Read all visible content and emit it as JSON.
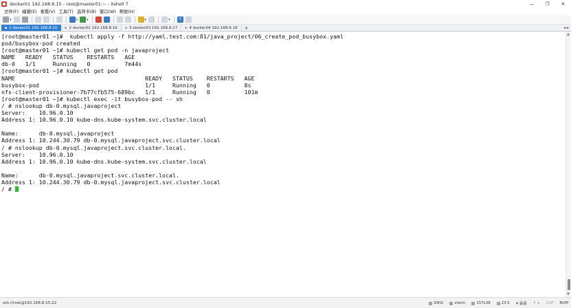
{
  "window": {
    "title": "docker01 192.168.8.15 - root@master01:~ - Xshell 7",
    "minimize_glyph": "—",
    "maximize_glyph": "❐",
    "close_glyph": "✕"
  },
  "menu": {
    "items": [
      "文件(F)",
      "编辑(E)",
      "查看(V)",
      "工具(T)",
      "选项卡(B)",
      "窗口(W)",
      "帮助(H)"
    ]
  },
  "tabs": [
    {
      "label": "1 docker01 192.168.8.15",
      "active": true
    },
    {
      "label": "2 docker02 192.168.8.16",
      "active": false
    },
    {
      "label": "3 docker03 192.168.8.17",
      "active": false
    },
    {
      "label": "4 docker04 192.168.8.18",
      "active": false
    }
  ],
  "tab_add_glyph": "+",
  "tab_nav_glyph": "◂ ▸",
  "terminal": {
    "lines": [
      "[root@master01 ~]#  kubectl apply -f http://yaml.test.com:81/java_project/06_create_pod_busybox.yaml",
      "pod/busybox-pod created",
      "[root@master01 ~]# kubectl get pod -n javaproject",
      "NAME   READY   STATUS    RESTARTS   AGE",
      "db-0   1/1     Running   0          7m44s",
      "[root@master01 ~]# kubectl get pod",
      "NAME                                      READY   STATUS    RESTARTS   AGE",
      "busybox-pod                               1/1     Running   0          8s",
      "nfs-client-provisioner-7b77cfb575-689bc   1/1     Running   0          101m",
      "[root@master01 ~]# kubectl exec -it busybox-pod -- sh",
      "/ # nslookup db-0.mysql.javaproject",
      "Server:    10.96.0.10",
      "Address 1: 10.96.0.10 kube-dns.kube-system.svc.cluster.local",
      "",
      "Name:      db-0.mysql.javaproject",
      "Address 1: 10.244.30.79 db-0.mysql.javaproject.svc.cluster.local",
      "/ # nslookup db-0.mysql.javaproject.svc.cluster.local.",
      "Server:    10.96.0.10",
      "Address 1: 10.96.0.10 kube-dns.kube-system.svc.cluster.local",
      "",
      "Name:      db-0.mysql.javaproject.svc.cluster.local.",
      "Address 1: 10.244.30.79 db-0.mysql.javaproject.svc.cluster.local"
    ],
    "prompt": "/ # ",
    "cursor_color": "#22c022"
  },
  "status": {
    "connection": "ssh://root@192.168.8.15:22",
    "protocol": "SSH2",
    "terminal_type": "xterm",
    "size": "157x38",
    "cursor_pos": "23,5",
    "sessions": "4 会话",
    "caps": "CAP",
    "num": "NUM"
  },
  "colors": {
    "active_tab": "#2f7fd6",
    "terminal_bg": "#ffffff",
    "terminal_fg": "#111111"
  }
}
